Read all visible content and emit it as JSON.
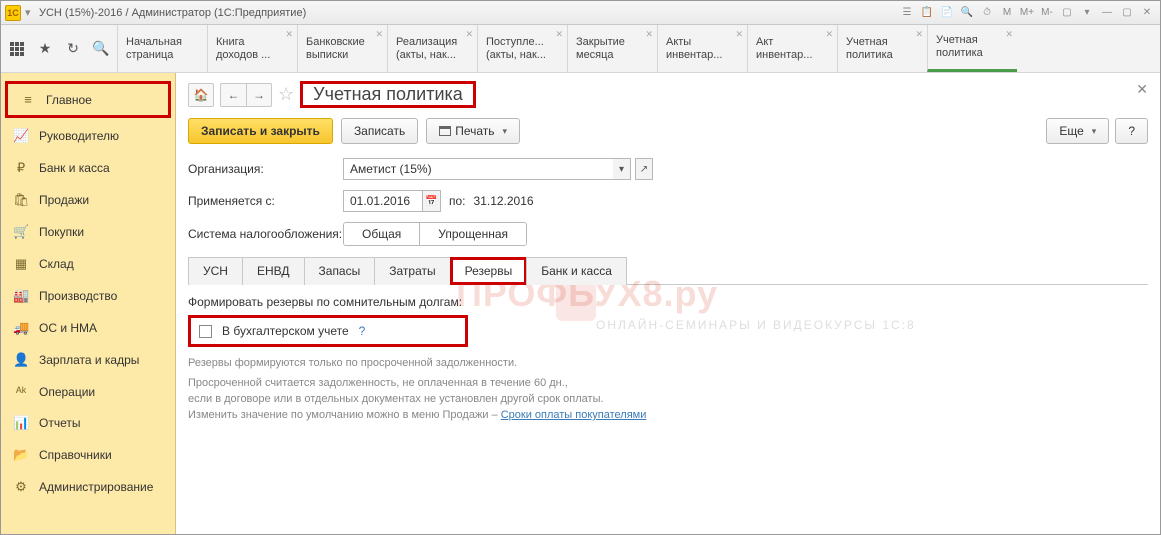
{
  "window": {
    "title": "УСН (15%)-2016 / Администратор  (1С:Предприятие)",
    "toolbar_letters": [
      "М",
      "М+",
      "М-"
    ]
  },
  "top_tabs": [
    {
      "line1": "Начальная",
      "line2": "страница"
    },
    {
      "line1": "Книга",
      "line2": "доходов ..."
    },
    {
      "line1": "Банковские",
      "line2": "выписки"
    },
    {
      "line1": "Реализация",
      "line2": "(акты, нак..."
    },
    {
      "line1": "Поступле...",
      "line2": "(акты, нак..."
    },
    {
      "line1": "Закрытие",
      "line2": "месяца"
    },
    {
      "line1": "Акты",
      "line2": "инвентар..."
    },
    {
      "line1": "Акт",
      "line2": "инвентар..."
    },
    {
      "line1": "Учетная",
      "line2": "политика"
    },
    {
      "line1": "Учетная",
      "line2": "политика"
    }
  ],
  "sidebar": {
    "items": [
      {
        "icon": "≡",
        "label": "Главное"
      },
      {
        "icon": "📈",
        "label": "Руководителю"
      },
      {
        "icon": "₽",
        "label": "Банк и касса"
      },
      {
        "icon": "🛍",
        "label": "Продажи"
      },
      {
        "icon": "🛒",
        "label": "Покупки"
      },
      {
        "icon": "▦",
        "label": "Склад"
      },
      {
        "icon": "🏭",
        "label": "Производство"
      },
      {
        "icon": "🚚",
        "label": "ОС и НМА"
      },
      {
        "icon": "👤",
        "label": "Зарплата и кадры"
      },
      {
        "icon": "ᴬᵏ",
        "label": "Операции"
      },
      {
        "icon": "📊",
        "label": "Отчеты"
      },
      {
        "icon": "📂",
        "label": "Справочники"
      },
      {
        "icon": "⚙",
        "label": "Администрирование"
      }
    ]
  },
  "page": {
    "title": "Учетная политика",
    "buttons": {
      "save_close": "Записать и закрыть",
      "save": "Записать",
      "print": "Печать",
      "more": "Еще",
      "help": "?"
    },
    "fields": {
      "org_label": "Организация:",
      "org_value": "Аметист (15%)",
      "applies_label": "Применяется с:",
      "date_from": "01.01.2016",
      "date_to_label": "по:",
      "date_to": "31.12.2016",
      "tax_system_label": "Система налогообложения:",
      "tax_general": "Общая",
      "tax_simplified": "Упрощенная"
    },
    "inner_tabs": [
      "УСН",
      "ЕНВД",
      "Запасы",
      "Затраты",
      "Резервы",
      "Банк и касса"
    ],
    "reserves": {
      "section_label": "Формировать резервы по сомнительным долгам:",
      "checkbox_label": "В бухгалтерском учете",
      "help": "?",
      "note1": "Резервы формируются только по просроченной задолженности.",
      "note2_a": "Просроченной считается задолженность, не оплаченная в течение 60 дн.,",
      "note2_b": "если в договоре или в отдельных документах не установлен другой срок оплаты.",
      "note2_c": "Изменить значение по умолчанию можно в меню Продажи – ",
      "link": "Сроки оплаты покупателями"
    }
  },
  "watermark": {
    "main": "ПРОФБУХ8.ру",
    "sub": "ОНЛАЙН-СЕМИНАРЫ И ВИДЕОКУРСЫ 1С:8"
  }
}
